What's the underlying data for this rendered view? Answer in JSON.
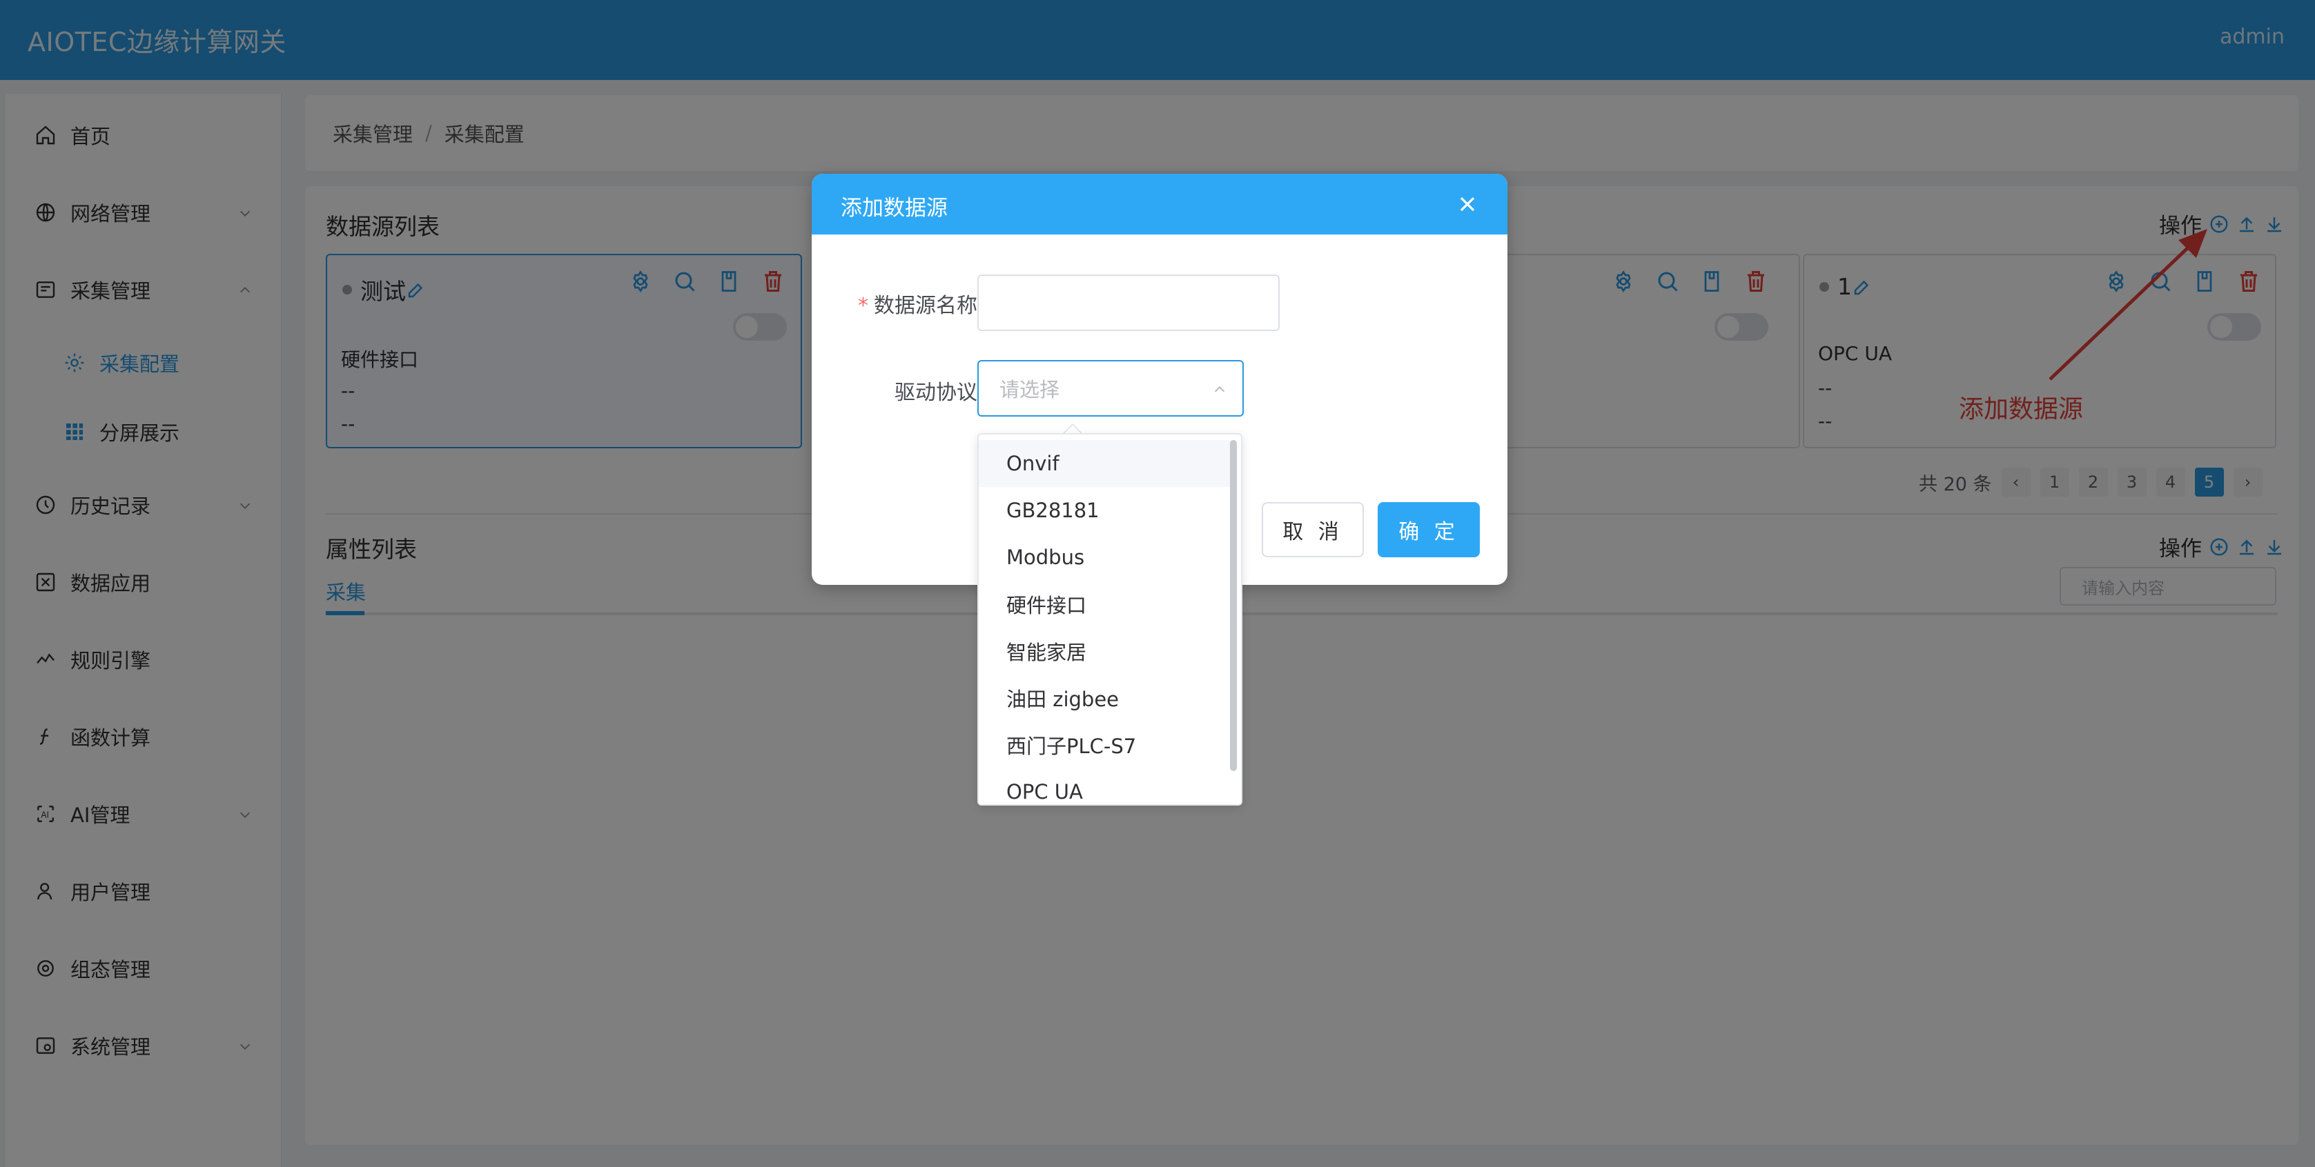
{
  "header": {
    "title": "AIOTEC边缘计算网关",
    "user": "admin"
  },
  "sidebar": {
    "items": [
      {
        "label": "首页",
        "icon": "home-icon"
      },
      {
        "label": "网络管理",
        "icon": "globe-icon",
        "expandable": true
      },
      {
        "label": "采集管理",
        "icon": "collect-icon",
        "expandable": true,
        "expanded": true
      },
      {
        "label": "采集配置",
        "icon": "gear-icon",
        "active": true
      },
      {
        "label": "分屏展示",
        "icon": "grid-icon"
      },
      {
        "label": "历史记录",
        "icon": "history-icon",
        "expandable": true
      },
      {
        "label": "数据应用",
        "icon": "data-app-icon"
      },
      {
        "label": "规则引擎",
        "icon": "rule-engine-icon"
      },
      {
        "label": "函数计算",
        "icon": "function-icon"
      },
      {
        "label": "AI管理",
        "icon": "ai-icon",
        "expandable": true
      },
      {
        "label": "用户管理",
        "icon": "user-icon"
      },
      {
        "label": "组态管理",
        "icon": "config-icon"
      },
      {
        "label": "系统管理",
        "icon": "system-icon",
        "expandable": true
      }
    ]
  },
  "breadcrumb": {
    "parent": "采集管理",
    "current": "采集配置",
    "separator": "/"
  },
  "datasource_list": {
    "title": "数据源列表",
    "ops_label": "操作",
    "cards": [
      {
        "name": "测试",
        "protocol": "硬件接口",
        "line2": "--",
        "line3": "--"
      },
      {
        "name": "1",
        "protocol": "OPC UA",
        "line2": "--",
        "line3": "--"
      }
    ],
    "pagination": {
      "total": "共 20 条",
      "pages": [
        "1",
        "2",
        "3",
        "4",
        "5"
      ],
      "current": "5"
    }
  },
  "attribute_list": {
    "title": "属性列表",
    "ops_label": "操作",
    "tab": "采集",
    "search_placeholder": "请输入内容"
  },
  "annotation": {
    "text": "添加数据源"
  },
  "dialog": {
    "title": "添加数据源",
    "required_mark": "*",
    "name_label": "数据源名称",
    "name_value": "",
    "protocol_label": "驱动协议",
    "protocol_placeholder": "请选择",
    "cancel_label": "取 消",
    "ok_label": "确 定"
  },
  "dropdown": {
    "options": [
      "Onvif",
      "GB28181",
      "Modbus",
      "硬件接口",
      "智能家居",
      "油田 zigbee",
      "西门子PLC-S7",
      "OPC UA"
    ],
    "hovered": "Onvif"
  },
  "colors": {
    "primary": "#2a98e0",
    "danger": "#e5403a",
    "mask": "rgba(0,0,0,0.5)"
  }
}
